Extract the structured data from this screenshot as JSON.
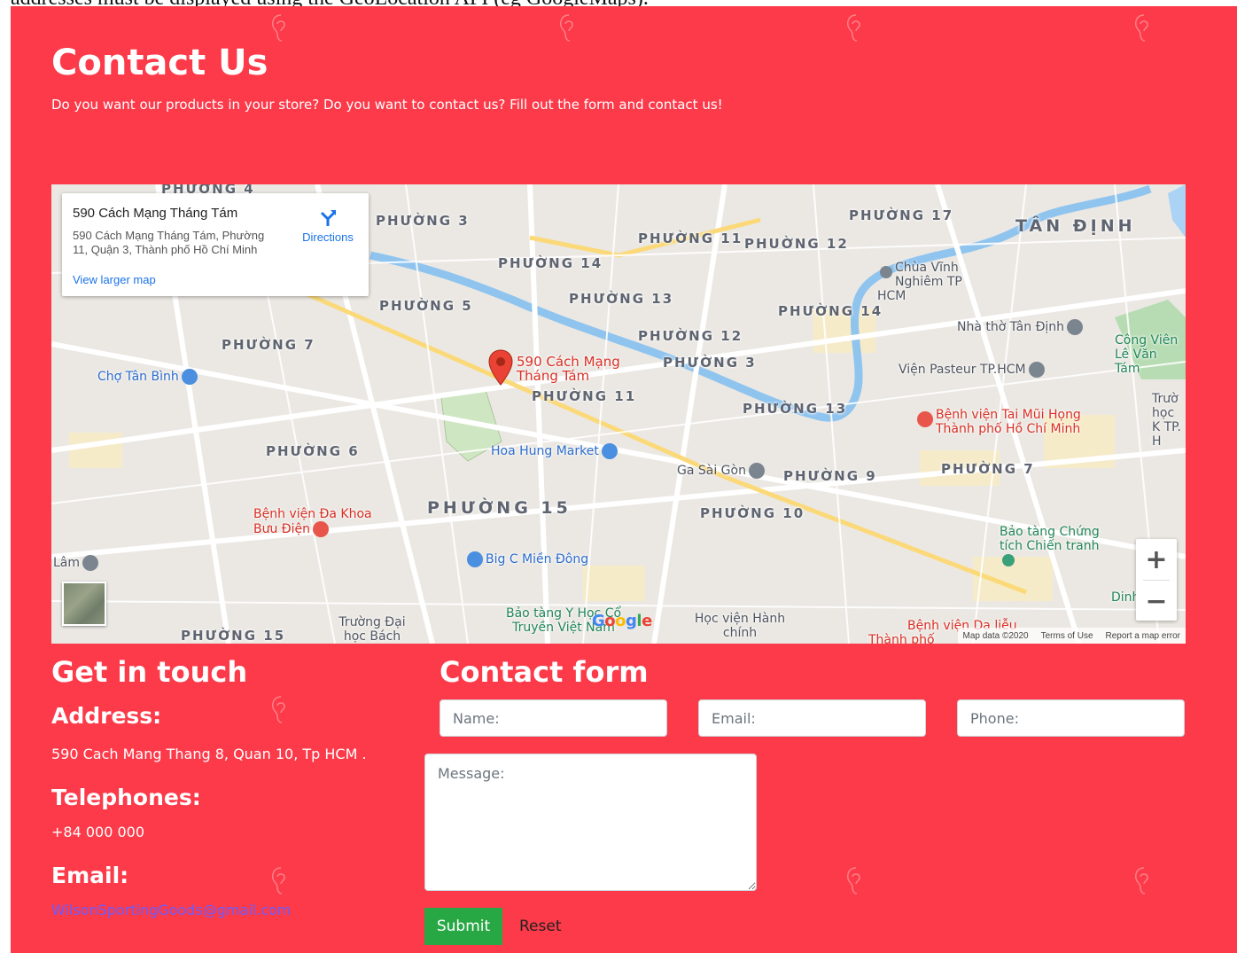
{
  "document": {
    "header_text": "addresses must be displayed using the GeoLocation API (eg GoogleMaps)."
  },
  "contact": {
    "title": "Contact Us",
    "subtitle": "Do you want our products in your store? Do you want to contact us? Fill out the form and contact us!"
  },
  "map": {
    "info_card": {
      "place_name": "590 Cách Mạng Tháng Tám",
      "place_address": "590 Cách Mạng Tháng Tám, Phường 11, Quận 3, Thành phố Hồ Chí Minh",
      "directions_label": "Directions",
      "larger_map_label": "View larger map"
    },
    "marker_label": "590 Cách Mạng Tháng Tám",
    "area_labels": [
      "PHƯỜNG 4",
      "PHƯỜNG 3",
      "PHƯỜNG 11",
      "PHUỜNG 12",
      "PHƯỜNG 17",
      "TÂN ĐỊNH",
      "PHƯỜNG 14",
      "PHƯỜNG 13",
      "PHƯỜNG 5",
      "PHƯỜNG 14",
      "PHƯỜNG 7",
      "PHƯỜNG 12",
      "PHƯỜNG 3",
      "PHƯỜNG 11",
      "PHƯỜNG 13",
      "PHƯỜNG 6",
      "PHƯỜNG 9",
      "PHƯỜNG 7",
      "PHƯỜNG 15",
      "PHƯỜNG 10",
      "PHƯỜNG 15"
    ],
    "pois": [
      "Chùa Vĩnh Nghiêm TP HCM",
      "Nhà thờ Tân Định",
      "Công Viên Lê Văn Tám",
      "Chợ Tân Bình",
      "Viện Pasteur TP.HCM",
      "Bệnh viện Tai Mũi Họng Thành phố Hồ Chí Minh",
      "Hoa Hung Market",
      "Ga Sài Gòn",
      "Bệnh viện Đa Khoa Bưu Điện",
      "Big C Miền Đông",
      "Bảo tàng Chứng tích Chiến tranh",
      "Lâm",
      "Bảo tàng Y Học Cổ Truyền Việt Nam",
      "Học viện Hành chính",
      "Trường Đại học Bách",
      "Dinh Đ",
      "Bệnh viện Da liễu",
      "Thành phố",
      "Trườ học K TP. H"
    ],
    "zoom_in": "+",
    "zoom_out": "−",
    "google_logo": "Google",
    "footer": {
      "data": "Map data ©2020",
      "terms": "Terms of Use",
      "report": "Report a map error"
    }
  },
  "get_in_touch": {
    "title": "Get in touch",
    "address_label": "Address:",
    "address_value": "590 Cach Mang Thang 8, Quan 10, Tp HCM .",
    "telephones_label": "Telephones:",
    "telephones_value": "+84 000 000",
    "email_label": "Email:",
    "email_value": "WilsonSportingGoods@gmail.com"
  },
  "form": {
    "title": "Contact form",
    "name_placeholder": "Name:",
    "email_placeholder": "Email:",
    "phone_placeholder": "Phone:",
    "message_placeholder": "Message:",
    "submit_label": "Submit",
    "reset_label": "Reset"
  },
  "colors": {
    "panel_bg": "#fc3a4a",
    "submit_bg": "#28a745",
    "link": "#6a5cff",
    "map_link": "#1a73e8"
  },
  "icons": {
    "watermark": "ear-icon",
    "directions": "directions-arrow-icon",
    "marker": "map-pin-icon"
  }
}
